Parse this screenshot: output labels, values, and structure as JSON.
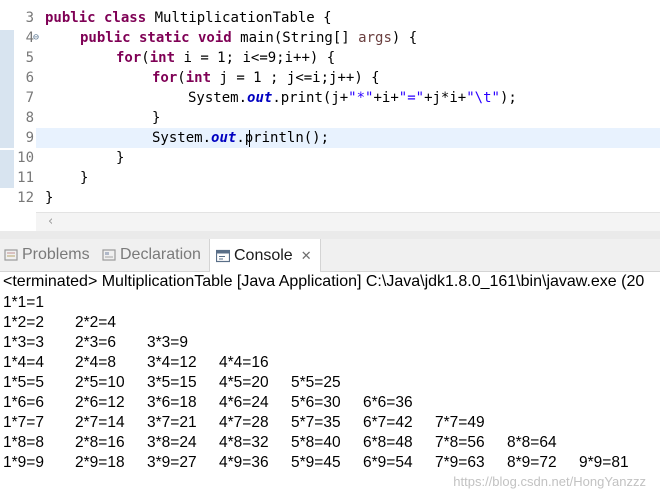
{
  "editor": {
    "lines": [
      {
        "num": "3",
        "fold": ""
      },
      {
        "num": "4",
        "fold": "⊖"
      },
      {
        "num": "5",
        "fold": ""
      },
      {
        "num": "6",
        "fold": ""
      },
      {
        "num": "7",
        "fold": ""
      },
      {
        "num": "8",
        "fold": ""
      },
      {
        "num": "9",
        "fold": ""
      },
      {
        "num": "10",
        "fold": ""
      },
      {
        "num": "11",
        "fold": ""
      },
      {
        "num": "12",
        "fold": ""
      }
    ],
    "code": {
      "l3_kw": "public class",
      "l3_rest": " MultiplicationTable {",
      "l4_kw": "public static void",
      "l4_a": " main(String[] ",
      "l4_param": "args",
      "l4_b": ") {",
      "l5_kw": "for",
      "l5_a": "(",
      "l5_kw2": "int",
      "l5_b": " i = 1; i<=9;i++) {",
      "l6_kw": "for",
      "l6_a": "(",
      "l6_kw2": "int",
      "l6_b": " j = 1 ; j<=i;j++) {",
      "l7_a": "System.",
      "l7_out": "out",
      "l7_b": ".print(j+",
      "l7_s1": "\"*\"",
      "l7_c": "+i+",
      "l7_s2": "\"=\"",
      "l7_d": "+j*i+",
      "l7_s3": "\"\\t\"",
      "l7_e": ");",
      "l8": "}",
      "l9_a": "System.",
      "l9_out": "out",
      "l9_b": ".println();",
      "l10": "}",
      "l11": "}",
      "l12": "}"
    }
  },
  "tabs": [
    {
      "label": "Problems",
      "icon": "problems-icon"
    },
    {
      "label": "Declaration",
      "icon": "declaration-icon"
    },
    {
      "label": "Console",
      "icon": "console-icon",
      "close": "✕"
    }
  ],
  "console": {
    "status": "<terminated> MultiplicationTable [Java Application] C:\\Java\\jdk1.8.0_161\\bin\\javaw.exe (20",
    "rows": [
      [
        "1*1=1"
      ],
      [
        "1*2=2",
        "2*2=4"
      ],
      [
        "1*3=3",
        "2*3=6",
        "3*3=9"
      ],
      [
        "1*4=4",
        "2*4=8",
        "3*4=12",
        "4*4=16"
      ],
      [
        "1*5=5",
        "2*5=10",
        "3*5=15",
        "4*5=20",
        "5*5=25"
      ],
      [
        "1*6=6",
        "2*6=12",
        "3*6=18",
        "4*6=24",
        "5*6=30",
        "6*6=36"
      ],
      [
        "1*7=7",
        "2*7=14",
        "3*7=21",
        "4*7=28",
        "5*7=35",
        "6*7=42",
        "7*7=49"
      ],
      [
        "1*8=8",
        "2*8=16",
        "3*8=24",
        "4*8=32",
        "5*8=40",
        "6*8=48",
        "7*8=56",
        "8*8=64"
      ],
      [
        "1*9=9",
        "2*9=18",
        "3*9=27",
        "4*9=36",
        "5*9=45",
        "6*9=54",
        "7*9=63",
        "8*9=72",
        "9*9=81"
      ]
    ]
  },
  "watermark": "https://blog.csdn.net/HongYanzzz",
  "colors": {
    "keyword": "#7f0055",
    "string": "#2a00ff",
    "static_field": "#0000c0",
    "current_line": "#e8f2fe"
  }
}
